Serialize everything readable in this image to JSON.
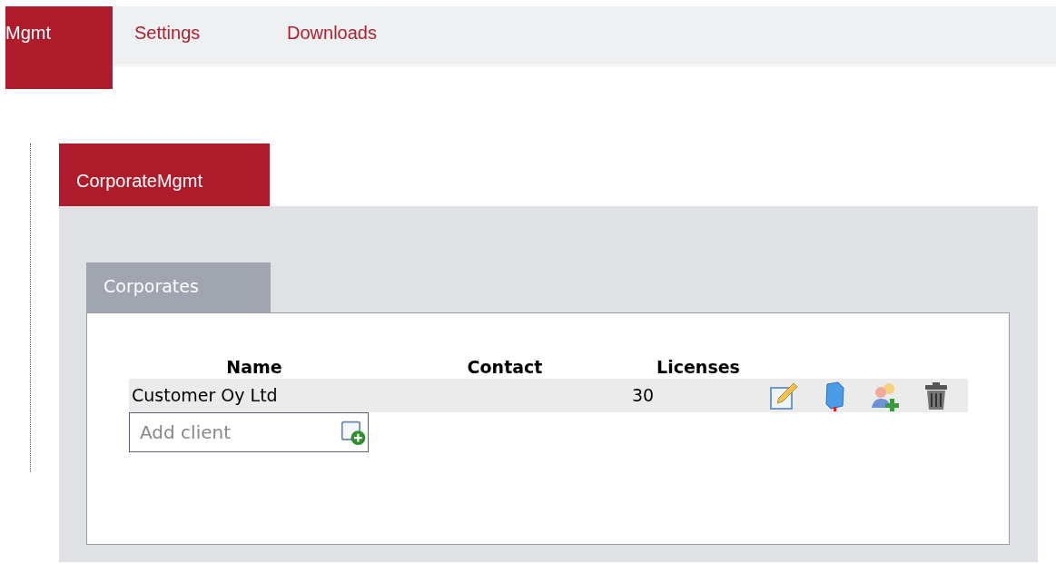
{
  "nav_tabs": [
    {
      "label": "Mgmt",
      "selected": true
    },
    {
      "label": "Settings",
      "selected": false
    },
    {
      "label": "Downloads",
      "selected": false
    }
  ],
  "section_tab": {
    "label": "CorporateMgmt",
    "selected": true
  },
  "panel_tab": {
    "label": "Corporates",
    "selected": true
  },
  "table": {
    "columns": [
      "Name",
      "Contact",
      "Licenses"
    ],
    "rows": [
      {
        "name": "Customer Oy Ltd",
        "licenses": "30"
      }
    ]
  },
  "add_client": {
    "placeholder": "Add client"
  }
}
